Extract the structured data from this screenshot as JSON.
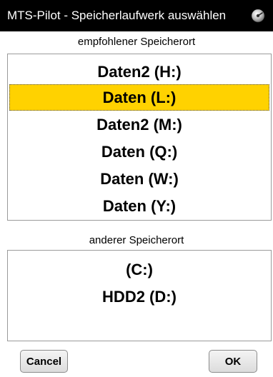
{
  "window": {
    "title": "MTS-Pilot - Speicherlaufwerk auswählen",
    "title_icon": "disk-drive-icon"
  },
  "recommended": {
    "label": "empfohlener Speicherort",
    "items": [
      {
        "label": "Daten2 (H:)",
        "selected": false
      },
      {
        "label": "Daten (L:)",
        "selected": true
      },
      {
        "label": "Daten2 (M:)",
        "selected": false
      },
      {
        "label": "Daten (Q:)",
        "selected": false
      },
      {
        "label": "Daten (W:)",
        "selected": false
      },
      {
        "label": "Daten (Y:)",
        "selected": false
      }
    ]
  },
  "other": {
    "label": "anderer Speicherort",
    "items": [
      {
        "label": "(C:)",
        "selected": false
      },
      {
        "label": "HDD2 (D:)",
        "selected": false
      }
    ]
  },
  "buttons": {
    "cancel_label": "Cancel",
    "ok_label": "OK"
  },
  "colors": {
    "titlebar_bg": "#000000",
    "selection": "#ffd200"
  }
}
